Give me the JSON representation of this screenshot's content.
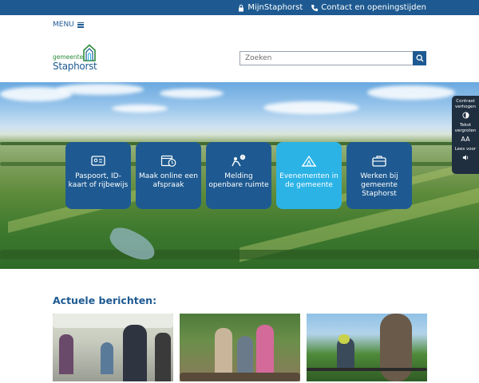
{
  "topbar": {
    "mijn_label": "MijnStaphorst",
    "contact_label": "Contact en openingstijden"
  },
  "menu": {
    "label": "MENU"
  },
  "logo": {
    "line1": "gemeente",
    "line2": "Staphorst"
  },
  "search": {
    "placeholder": "Zoeken"
  },
  "tiles": [
    {
      "label": "Paspoort, ID-kaart of rijbewijs",
      "icon": "id-card-icon"
    },
    {
      "label": "Maak online een afspraak",
      "icon": "calendar-clock-icon"
    },
    {
      "label": "Melding openbare ruimte",
      "icon": "worker-warning-icon"
    },
    {
      "label": "Evenementen in de gemeente",
      "icon": "tent-icon"
    },
    {
      "label": "Werken bij gemeente Staphorst",
      "icon": "briefcase-icon"
    }
  ],
  "accessibility": {
    "contrast_label": "Contrast verhogen",
    "text_label": "Tekst vergroten",
    "text_icon": "AA",
    "read_label": "Lees voor"
  },
  "news": {
    "title": "Actuele berichten:",
    "cards": [
      {
        "image": "people-indoor-photo"
      },
      {
        "image": "people-forest-photo"
      },
      {
        "image": "tree-worker-photo"
      }
    ]
  },
  "colors": {
    "primary": "#1e5a91",
    "accent": "#2bb3e6",
    "green": "#2c8a3b"
  }
}
